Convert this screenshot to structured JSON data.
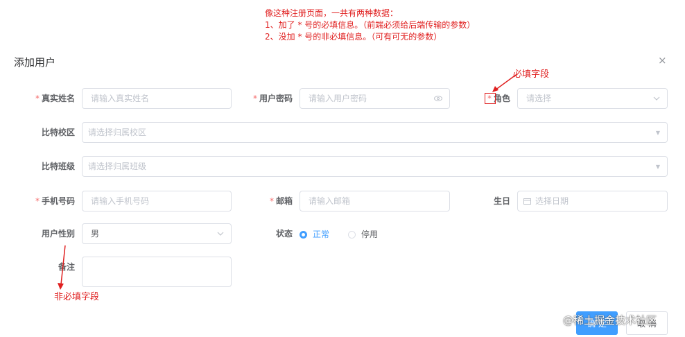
{
  "annotation": {
    "line1": "像这种注册页面，一共有两种数据：",
    "line2": "1、加了 * 号的必填信息。（前端必须给后端传输的参数）",
    "line3": "2、没加 * 号的非必填信息。（可有可无的参数）",
    "required_label": "必填字段",
    "optional_label": "非必填字段",
    "asterisk": "*",
    "color": "#e02020"
  },
  "dialog": {
    "title": "添加用户",
    "close": "×"
  },
  "form": {
    "required_mark": "*",
    "real_name": {
      "label": "真实姓名",
      "placeholder": "请输入真实姓名"
    },
    "password": {
      "label": "用户密码",
      "placeholder": "请输入用户密码"
    },
    "role": {
      "label": "角色",
      "placeholder": "请选择"
    },
    "campus": {
      "label": "比特校区",
      "placeholder": "请选择归属校区"
    },
    "class": {
      "label": "比特班级",
      "placeholder": "请选择归属班级"
    },
    "phone": {
      "label": "手机号码",
      "placeholder": "请输入手机号码"
    },
    "email": {
      "label": "邮箱",
      "placeholder": "请输入邮箱"
    },
    "birthday": {
      "label": "生日",
      "placeholder": "选择日期"
    },
    "gender": {
      "label": "用户性别",
      "value": "男"
    },
    "status": {
      "label": "状态",
      "options": [
        "正常",
        "停用"
      ]
    },
    "remark": {
      "label": "备注"
    }
  },
  "footer": {
    "confirm": "确 定",
    "cancel": "取 消"
  },
  "watermark": "@稀土掘金技术社区",
  "colors": {
    "primary": "#409eff",
    "required": "#f56c6c"
  }
}
